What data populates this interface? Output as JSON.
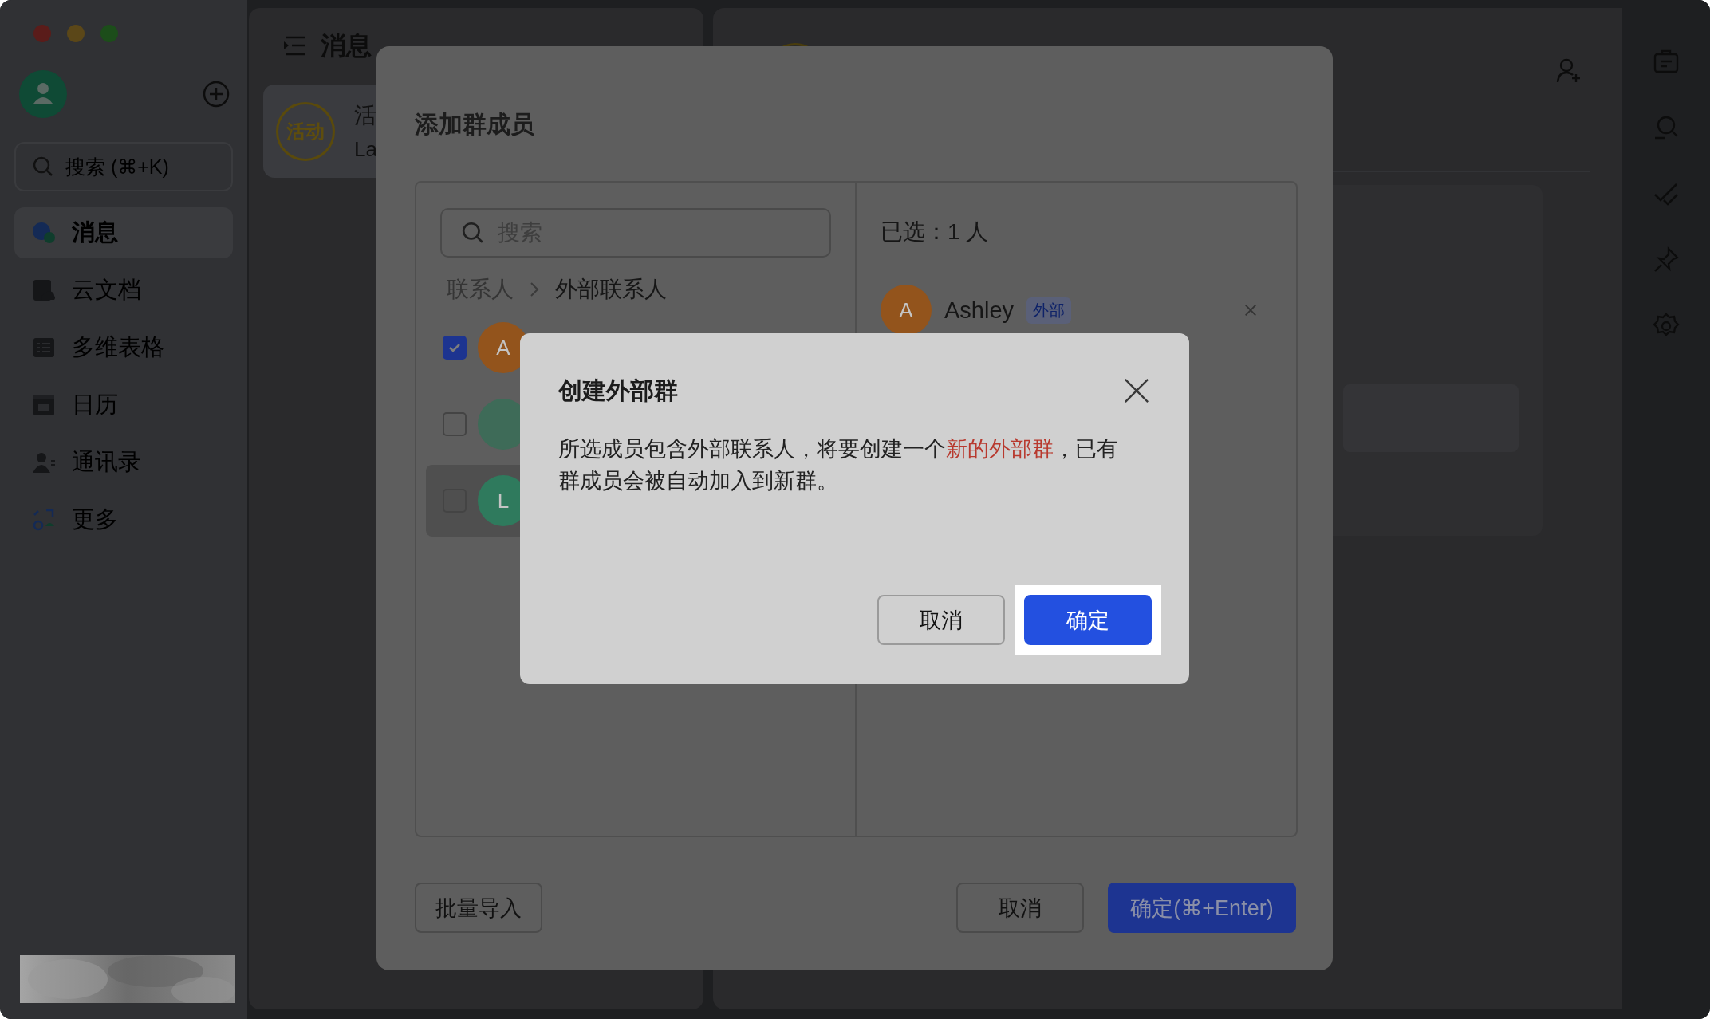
{
  "sidebar": {
    "search_placeholder": "搜索 (⌘+K)",
    "items": [
      {
        "label": "消息",
        "kind": "messages",
        "selected": true
      },
      {
        "label": "云文档",
        "kind": "docs",
        "selected": false
      },
      {
        "label": "多维表格",
        "kind": "base",
        "selected": false
      },
      {
        "label": "日历",
        "kind": "calendar",
        "selected": false
      },
      {
        "label": "通讯录",
        "kind": "contacts",
        "selected": false
      },
      {
        "label": "更多",
        "kind": "more",
        "selected": false
      }
    ]
  },
  "message_panel": {
    "title": "消息",
    "chats": [
      {
        "avatar_text": "活动",
        "name": "活",
        "preview": "La"
      }
    ]
  },
  "add_members_dialog": {
    "title": "添加群成员",
    "search_placeholder": "搜索",
    "breadcrumb": [
      "联系人",
      "外部联系人"
    ],
    "contacts": [
      {
        "initial": "A",
        "color": "#93541c",
        "checked": true,
        "hovered": false
      },
      {
        "color": "#3e6b58",
        "checked": false,
        "hovered": false
      },
      {
        "initial": "L",
        "color": "#2f7a5d",
        "checked": false,
        "hovered": true
      }
    ],
    "selected_count": "已选：1 人",
    "selected": [
      {
        "initial": "A",
        "color": "#93541c",
        "name": "Ashley",
        "tag": "外部"
      }
    ],
    "import_button": "批量导入",
    "cancel_button": "取消",
    "confirm_button": "确定(⌘+Enter)"
  },
  "confirm_dialog": {
    "title": "创建外部群",
    "message": [
      {
        "text": "所选成员包含外部联系人，将要创建一个",
        "highlight": false
      },
      {
        "text": "新的外部群",
        "highlight": true
      },
      {
        "text": "，已有群成员会被自动加入到新群。",
        "highlight": false
      }
    ],
    "cancel_button": "取消",
    "confirm_button": "确定",
    "confirm_spotlight": true
  }
}
